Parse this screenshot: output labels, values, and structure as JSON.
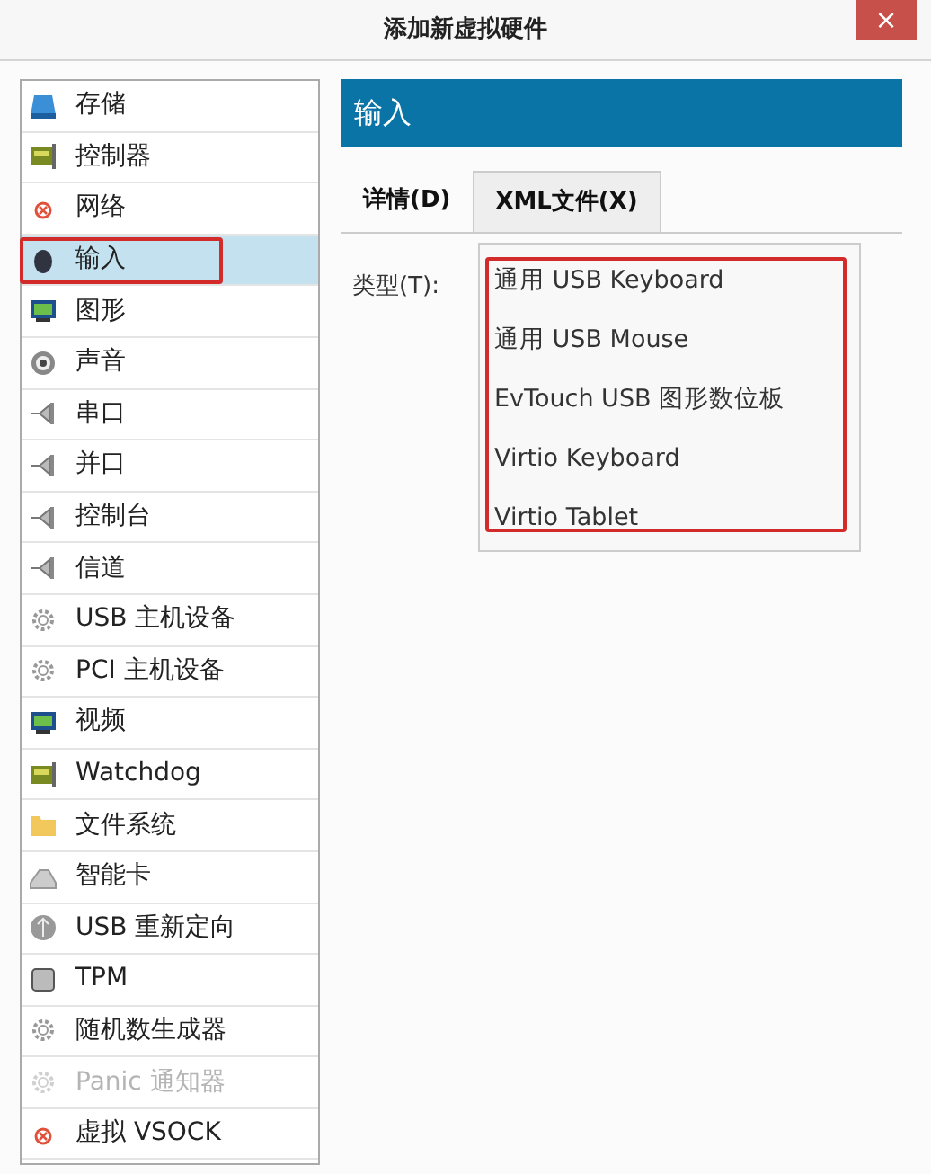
{
  "window": {
    "title": "添加新虚拟硬件",
    "close": "×"
  },
  "sidebar": {
    "items": [
      {
        "label": "存储",
        "kind": "disk",
        "selected": false,
        "disabled": false,
        "annotated": false
      },
      {
        "label": "控制器",
        "kind": "card",
        "selected": false,
        "disabled": false,
        "annotated": false
      },
      {
        "label": "网络",
        "kind": "error",
        "selected": false,
        "disabled": false,
        "annotated": false
      },
      {
        "label": "输入",
        "kind": "mouse",
        "selected": true,
        "disabled": false,
        "annotated": true
      },
      {
        "label": "图形",
        "kind": "monitor",
        "selected": false,
        "disabled": false,
        "annotated": false
      },
      {
        "label": "声音",
        "kind": "speaker",
        "selected": false,
        "disabled": false,
        "annotated": false
      },
      {
        "label": "串口",
        "kind": "plug",
        "selected": false,
        "disabled": false,
        "annotated": false
      },
      {
        "label": "并口",
        "kind": "plug",
        "selected": false,
        "disabled": false,
        "annotated": false
      },
      {
        "label": "控制台",
        "kind": "plug",
        "selected": false,
        "disabled": false,
        "annotated": false
      },
      {
        "label": "信道",
        "kind": "plug",
        "selected": false,
        "disabled": false,
        "annotated": false
      },
      {
        "label": "USB 主机设备",
        "kind": "gear",
        "selected": false,
        "disabled": false,
        "annotated": false
      },
      {
        "label": "PCI 主机设备",
        "kind": "gear",
        "selected": false,
        "disabled": false,
        "annotated": false
      },
      {
        "label": "视频",
        "kind": "monitor",
        "selected": false,
        "disabled": false,
        "annotated": false
      },
      {
        "label": "Watchdog",
        "kind": "card",
        "selected": false,
        "disabled": false,
        "annotated": false
      },
      {
        "label": "文件系统",
        "kind": "folder",
        "selected": false,
        "disabled": false,
        "annotated": false
      },
      {
        "label": "智能卡",
        "kind": "smartcard",
        "selected": false,
        "disabled": false,
        "annotated": false
      },
      {
        "label": "USB 重新定向",
        "kind": "usb",
        "selected": false,
        "disabled": false,
        "annotated": false
      },
      {
        "label": "TPM",
        "kind": "chip",
        "selected": false,
        "disabled": false,
        "annotated": false
      },
      {
        "label": "随机数生成器",
        "kind": "gear",
        "selected": false,
        "disabled": false,
        "annotated": false
      },
      {
        "label": "Panic 通知器",
        "kind": "gear",
        "selected": false,
        "disabled": true,
        "annotated": false
      },
      {
        "label": "虚拟 VSOCK",
        "kind": "error",
        "selected": false,
        "disabled": false,
        "annotated": false
      }
    ]
  },
  "panel": {
    "header": "输入",
    "tabs": [
      {
        "label": "详情(D)",
        "selected": true
      },
      {
        "label": "XML文件(X)",
        "selected": false
      }
    ],
    "type_label": "类型(T):",
    "dropdown": {
      "annotated": true,
      "options": [
        "通用 USB Keyboard",
        "通用 USB Mouse",
        "EvTouch USB 图形数位板",
        "Virtio Keyboard",
        "Virtio Tablet"
      ]
    }
  }
}
